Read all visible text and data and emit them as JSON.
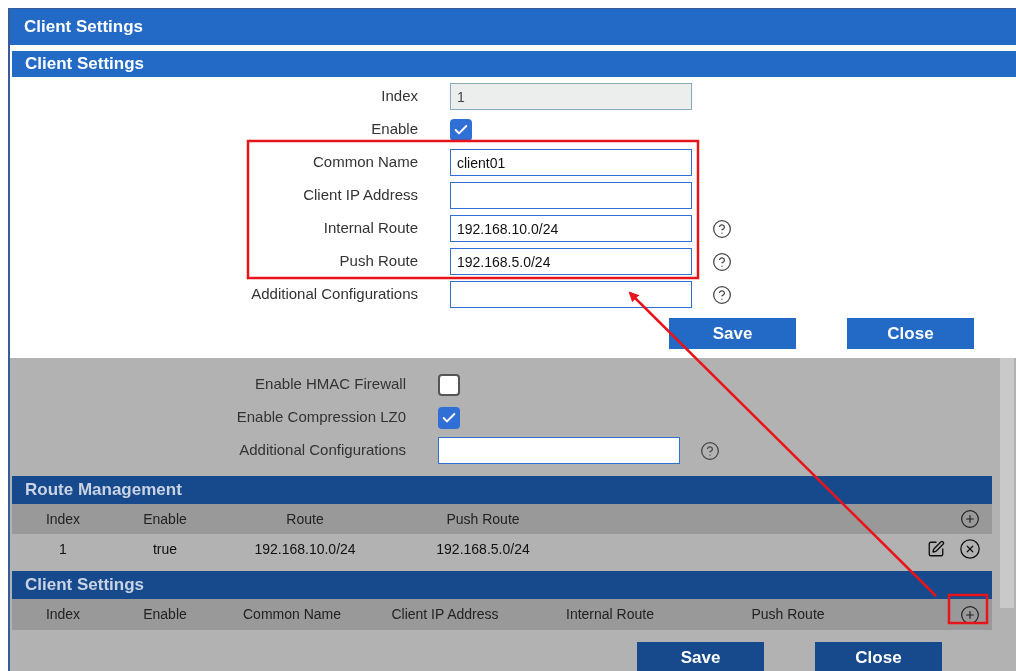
{
  "window": {
    "title": "Client Settings"
  },
  "dialog": {
    "title": "Client Settings",
    "fields": [
      {
        "label": "Index",
        "kind": "text",
        "value": "1",
        "disabled": true,
        "help": false
      },
      {
        "label": "Enable",
        "kind": "checkbox",
        "checked": true
      },
      {
        "label": "Common Name",
        "kind": "text",
        "value": "client01",
        "disabled": false,
        "help": false
      },
      {
        "label": "Client IP Address",
        "kind": "text",
        "disabled": false,
        "help": false
      },
      {
        "label": "Internal Route",
        "kind": "text",
        "value": "192.168.10.0/24",
        "disabled": false,
        "help": true
      },
      {
        "label": "Push Route",
        "kind": "text",
        "value": "192.168.5.0/24",
        "disabled": false,
        "help": true
      },
      {
        "label": "Additional Configurations",
        "kind": "text",
        "disabled": false,
        "help": true
      }
    ],
    "buttons": [
      "Save",
      "Close"
    ]
  },
  "page": {
    "fields": [
      {
        "label": "Enable HMAC Firewall",
        "kind": "checkbox",
        "checked": false
      },
      {
        "label": "Enable Compression LZ0",
        "kind": "checkbox",
        "checked": true
      },
      {
        "label": "Additional Configurations",
        "kind": "text",
        "disabled": false,
        "help": true
      }
    ],
    "route_management": {
      "title": "Route Management",
      "columns": [
        "Index",
        "Enable",
        "Route",
        "Push Route"
      ],
      "rows": [
        [
          "1",
          "true",
          "192.168.10.0/24",
          "192.168.5.0/24"
        ]
      ]
    },
    "client_settings": {
      "title": "Client Settings",
      "columns": [
        "Index",
        "Enable",
        "Common Name",
        "Client IP Address",
        "Internal Route",
        "Push Route"
      ]
    },
    "buttons": [
      "Save",
      "Close"
    ]
  }
}
